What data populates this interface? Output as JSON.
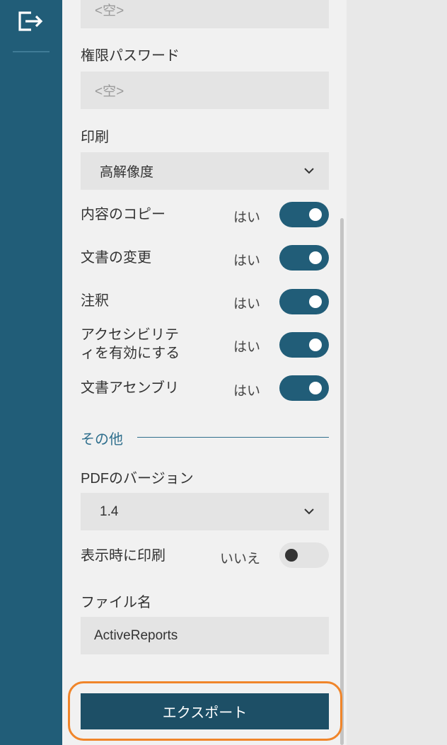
{
  "sidebar": {
    "exit_icon": "exit-icon",
    "color": "#215d78"
  },
  "fields": {
    "top_password": {
      "placeholder": "<空>"
    },
    "permission_password": {
      "label": "権限パスワード",
      "placeholder": "<空>"
    },
    "printing": {
      "label": "印刷",
      "value": "高解像度"
    }
  },
  "toggles": [
    {
      "label": "内容のコピー",
      "value": "はい",
      "on": true
    },
    {
      "label": "文書の変更",
      "value": "はい",
      "on": true
    },
    {
      "label": "注釈",
      "value": "はい",
      "on": true
    },
    {
      "label_line1": "アクセシビリテ",
      "label_line2": "ィを有効にする",
      "value": "はい",
      "on": true
    },
    {
      "label": "文書アセンブリ",
      "value": "はい",
      "on": true
    }
  ],
  "other": {
    "section_title": "その他",
    "pdf_version": {
      "label": "PDFのバージョン",
      "value": "1.4"
    },
    "print_on_open": {
      "label": "表示時に印刷",
      "value": "いいえ",
      "on": false
    },
    "file_name": {
      "label": "ファイル名",
      "value": "ActiveReports"
    }
  },
  "export": {
    "label": "エクスポート",
    "highlight_color": "#f0852a",
    "color": "#1d4f66"
  }
}
